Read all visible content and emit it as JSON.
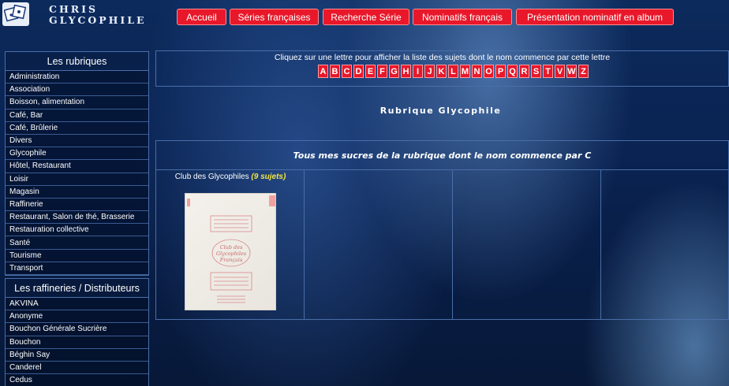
{
  "logo": {
    "line1": "CHRIS",
    "line2": "GLYCOPHILE",
    "icon": "glycophile-logo-icon"
  },
  "nav": [
    {
      "label": "Accueil"
    },
    {
      "label": "Séries françaises"
    },
    {
      "label": "Recherche Série"
    },
    {
      "label": "Nominatifs français"
    },
    {
      "label": "Présentation nominatif en album"
    }
  ],
  "sidebar": {
    "rubriques_title": "Les rubriques",
    "rubriques": [
      "Administration",
      "Association",
      "Boisson, alimentation",
      "Café, Bar",
      "Café, Brûlerie",
      "Divers",
      "Glycophile",
      "Hôtel, Restaurant",
      "Loisir",
      "Magasin",
      "Raffinerie",
      "Restaurant, Salon de thé, Brasserie",
      "Restauration collective",
      "Santé",
      "Tourisme",
      "Transport"
    ],
    "raffineries_title": "Les raffineries / Distributeurs",
    "raffineries": [
      "AKVINA",
      "Anonyme",
      "Bouchon Générale Sucrière",
      "Bouchon",
      "Béghin Say",
      "Canderel",
      "Cedus"
    ]
  },
  "letters": {
    "hint": "Cliquez sur une lettre pour afficher la liste des sujets dont le nom commence par cette lettre",
    "items": [
      "A",
      "B",
      "C",
      "D",
      "E",
      "F",
      "G",
      "H",
      "I",
      "J",
      "K",
      "L",
      "M",
      "N",
      "O",
      "P",
      "Q",
      "R",
      "S",
      "T",
      "V",
      "W",
      "Z"
    ]
  },
  "rubrique_title": "Rubrique Glycophile",
  "section": {
    "heading": "Tous mes sucres de la rubrique dont le nom commence par C",
    "items": [
      {
        "title": "Club des Glycophiles",
        "count": "(9 sujets)",
        "image_alt": "sugar-packet-image",
        "image_text": [
          "Club des",
          "Glycophiles",
          "Français"
        ]
      }
    ]
  },
  "colors": {
    "accent_red": "#e8182a",
    "count_yellow": "#f5e642",
    "border": "#4a6ea8"
  }
}
